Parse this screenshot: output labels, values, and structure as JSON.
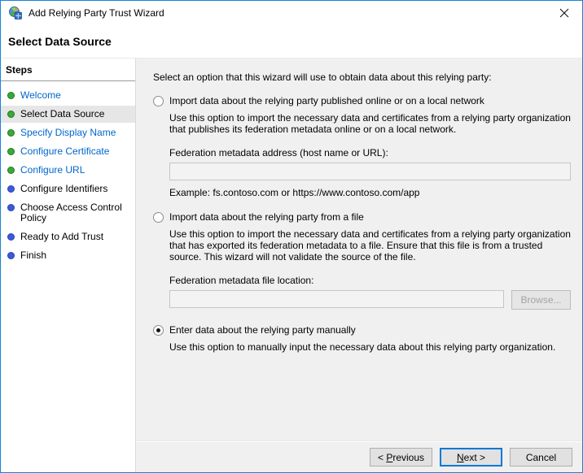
{
  "window": {
    "title": "Add Relying Party Trust Wizard"
  },
  "page_title": "Select Data Source",
  "sidebar": {
    "heading": "Steps",
    "items": [
      {
        "label": "Welcome",
        "state": "link",
        "bullet": "green"
      },
      {
        "label": "Select Data Source",
        "state": "current",
        "bullet": "green"
      },
      {
        "label": "Specify Display Name",
        "state": "link",
        "bullet": "green"
      },
      {
        "label": "Configure Certificate",
        "state": "link",
        "bullet": "green"
      },
      {
        "label": "Configure URL",
        "state": "link",
        "bullet": "green"
      },
      {
        "label": "Configure Identifiers",
        "state": "future",
        "bullet": "blue"
      },
      {
        "label": "Choose Access Control Policy",
        "state": "future",
        "bullet": "blue"
      },
      {
        "label": "Ready to Add Trust",
        "state": "future",
        "bullet": "blue"
      },
      {
        "label": "Finish",
        "state": "future",
        "bullet": "blue"
      }
    ]
  },
  "content": {
    "intro": "Select an option that this wizard will use to obtain data about this relying party:",
    "options": [
      {
        "label": "Import data about the relying party published online or on a local network",
        "selected": false,
        "description": "Use this option to import the necessary data and certificates from a relying party organization that publishes its federation metadata online or on a local network.",
        "field_label": "Federation metadata address (host name or URL):",
        "field_value": "",
        "example": "Example: fs.contoso.com or https://www.contoso.com/app"
      },
      {
        "label": "Import data about the relying party from a file",
        "selected": false,
        "description": "Use this option to import the necessary data and certificates from a relying party organization that has exported its federation metadata to a file. Ensure that this file is from a trusted source.  This wizard will not validate the source of the file.",
        "field_label": "Federation metadata file location:",
        "field_value": "",
        "browse_label": "Browse..."
      },
      {
        "label": "Enter data about the relying party manually",
        "selected": true,
        "description": "Use this option to manually input the necessary data about this relying party organization."
      }
    ]
  },
  "footer": {
    "previous": {
      "pre": "< ",
      "accel": "P",
      "rest": "revious"
    },
    "next": {
      "accel": "N",
      "rest": "ext >"
    },
    "cancel": "Cancel"
  },
  "icons": {
    "app": "adfs-trust-icon",
    "close": "close-icon"
  },
  "colors": {
    "window_border": "#1883d7",
    "accent": "#0078d7",
    "link": "#0066cc",
    "step_done_bullet": "#3aa83a",
    "step_future_bullet": "#3b5ad8",
    "current_step_highlight": "#e6e6e6",
    "content_background": "#f0f0f0"
  }
}
